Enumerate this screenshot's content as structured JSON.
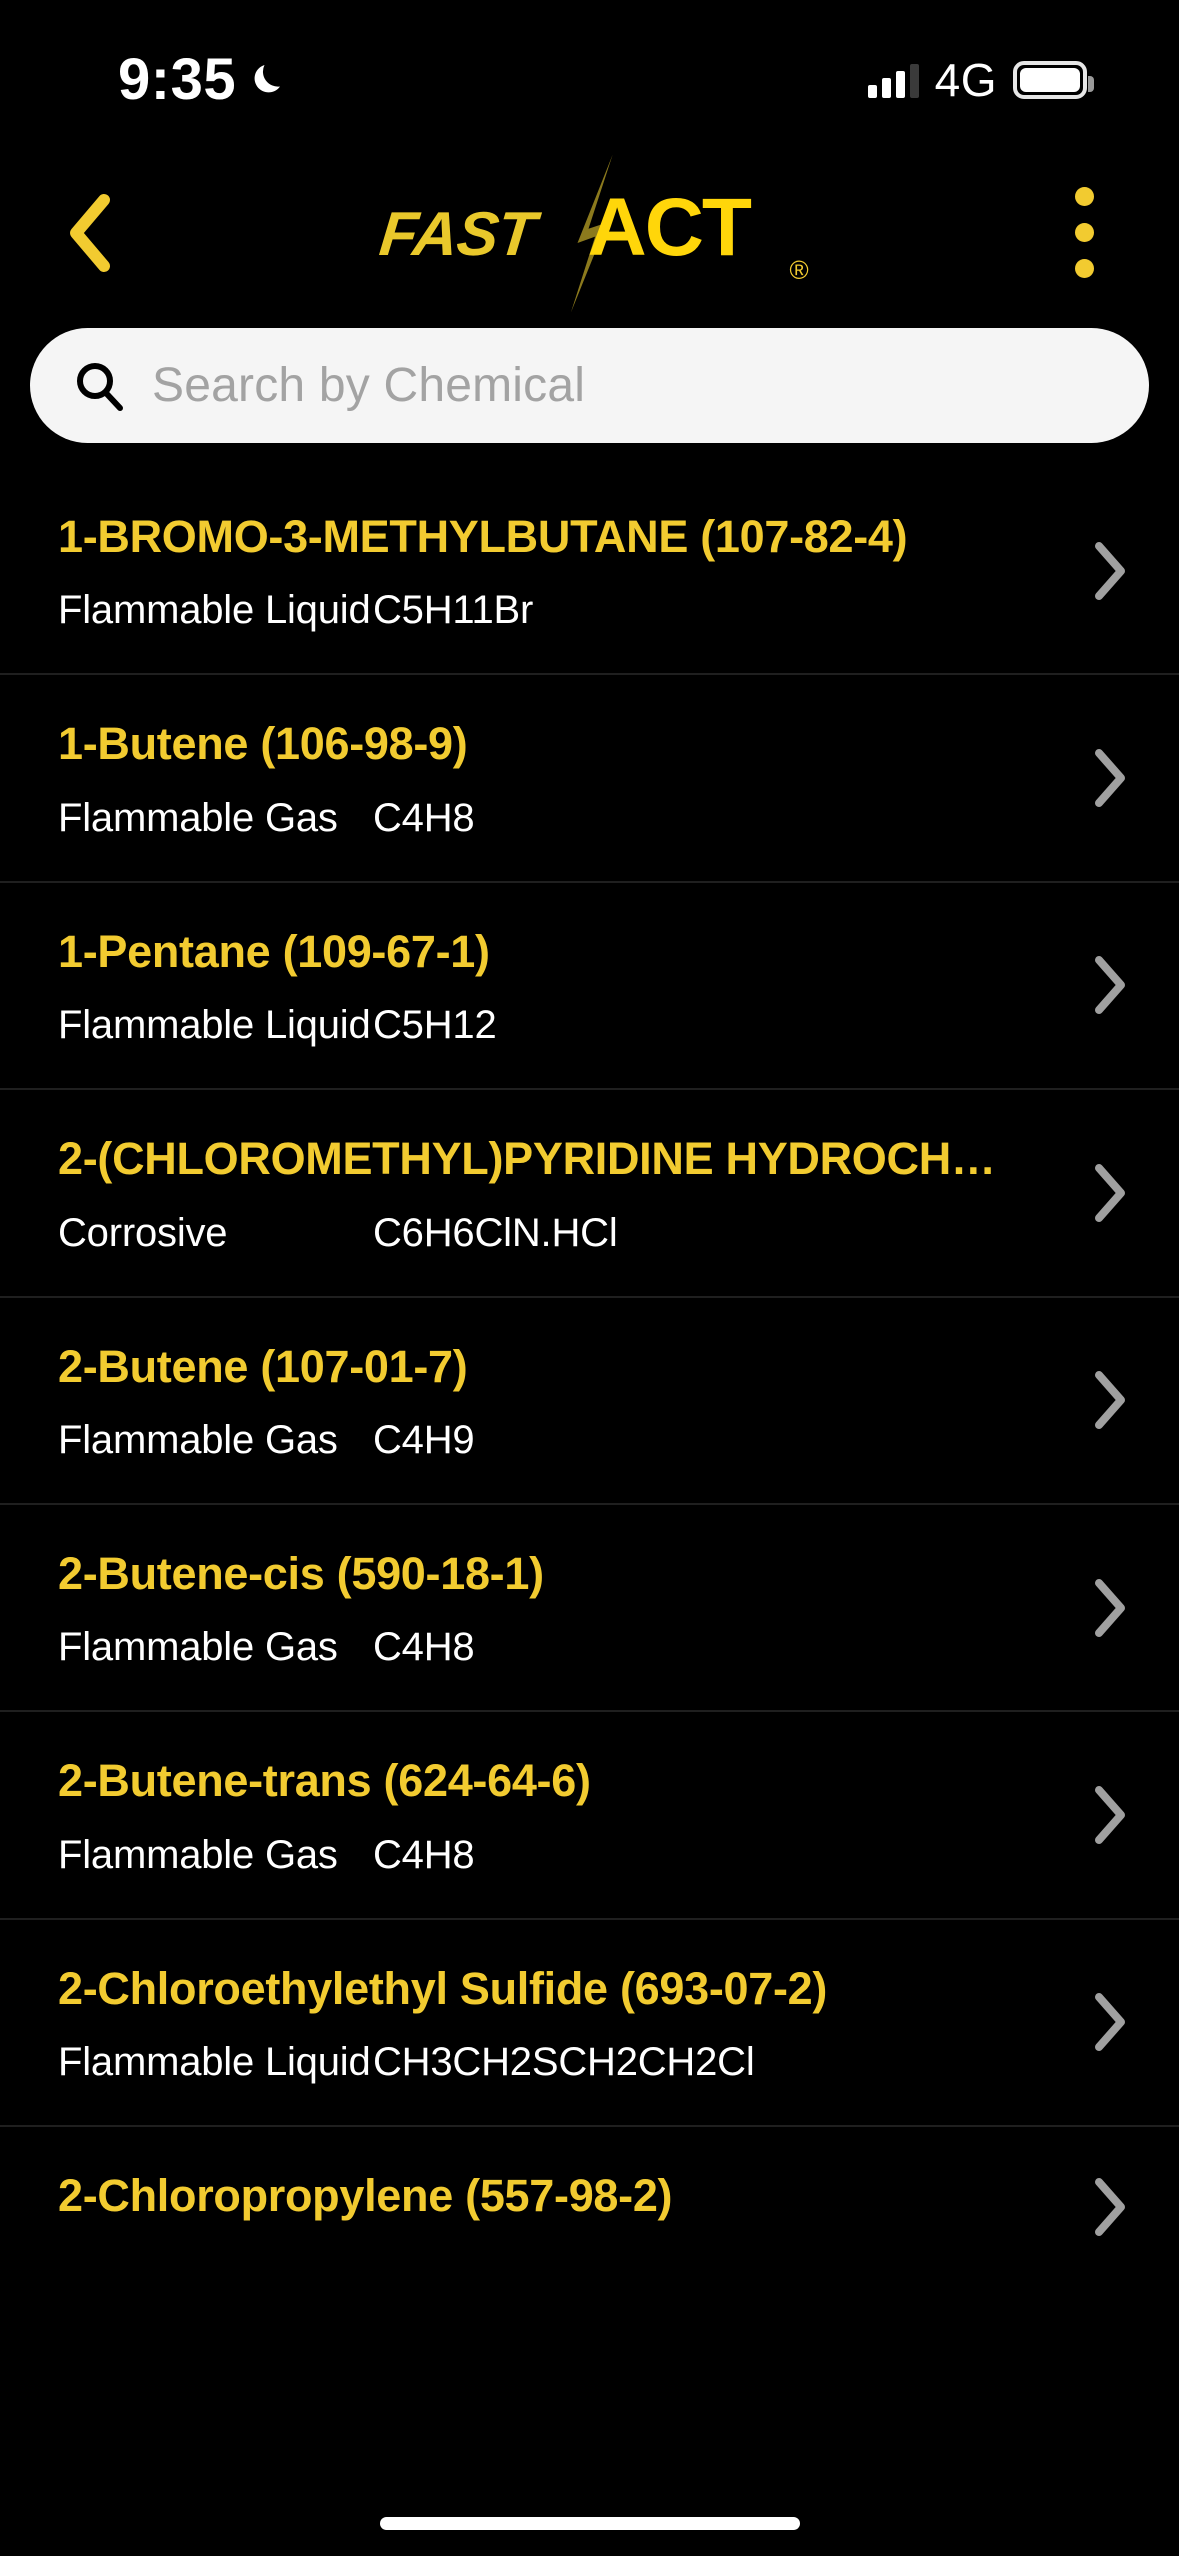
{
  "status_bar": {
    "time": "9:35",
    "dnd_icon": "crescent-moon-icon",
    "signal_icon": "cellular-bars-icon",
    "network": "4G",
    "battery_icon": "battery-full-icon"
  },
  "nav": {
    "back_icon": "chevron-left-icon",
    "more_icon": "overflow-menu-icon",
    "logo": {
      "part1": "FAST",
      "part2": "ACT",
      "registered": "®",
      "bolt_icon": "lightning-bolt-icon"
    }
  },
  "search": {
    "placeholder": "Search by Chemical",
    "value": "",
    "icon": "search-icon"
  },
  "colors": {
    "accent_yellow": "#F2CB30",
    "logo_gold": "#E9C82B",
    "logo_bright": "#FFD60A",
    "bolt_olive": "#8C7A1D",
    "background": "#000000",
    "search_bg": "#F5F5F5",
    "divider": "#1F1F1F",
    "chevron_gray": "#A0A0A0"
  },
  "list": {
    "chevron_icon": "chevron-right-icon",
    "items": [
      {
        "name": "1-BROMO-3-METHYLBUTANE (107-82-4)",
        "hazard": "Flammable Liquid",
        "formula": "C5H11Br"
      },
      {
        "name": "1-Butene (106-98-9)",
        "hazard": "Flammable Gas",
        "formula": "C4H8"
      },
      {
        "name": "1-Pentane (109-67-1)",
        "hazard": "Flammable Liquid",
        "formula": "C5H12"
      },
      {
        "name": "2-(CHLOROMETHYL)PYRIDINE HYDROCH…",
        "hazard": "Corrosive",
        "formula": "C6H6ClN.HCl"
      },
      {
        "name": "2-Butene (107-01-7)",
        "hazard": "Flammable Gas",
        "formula": "C4H9"
      },
      {
        "name": "2-Butene-cis (590-18-1)",
        "hazard": "Flammable Gas",
        "formula": "C4H8"
      },
      {
        "name": "2-Butene-trans (624-64-6)",
        "hazard": "Flammable Gas",
        "formula": "C4H8"
      },
      {
        "name": "2-Chloroethylethyl Sulfide (693-07-2)",
        "hazard": "Flammable Liquid",
        "formula": "CH3CH2SCH2CH2Cl"
      },
      {
        "name": "2-Chloropropylene (557-98-2)",
        "hazard": "",
        "formula": ""
      }
    ]
  },
  "home_indicator": "home-indicator"
}
